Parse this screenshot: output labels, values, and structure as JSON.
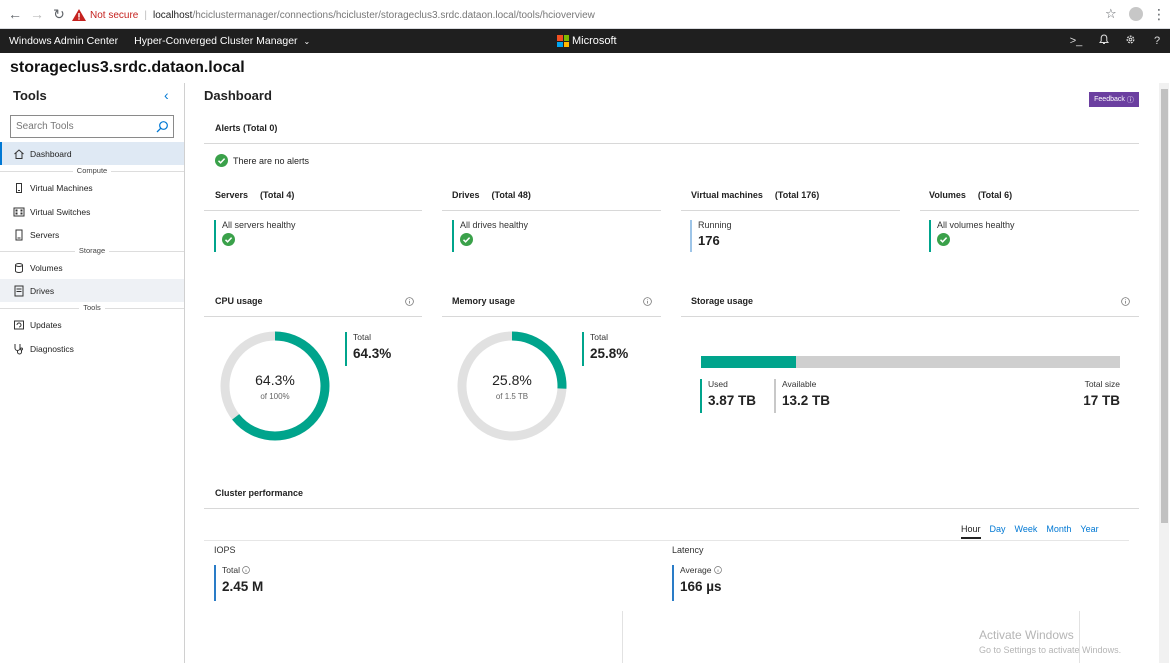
{
  "browser": {
    "not_secure": "Not secure",
    "url_host": "localhost",
    "url_path": "/hciclustermanager/connections/hcicluster/storageclus3.srdc.dataon.local/tools/hcioverview"
  },
  "app": {
    "name": "Windows Admin Center",
    "manager": "Hyper-Converged Cluster Manager",
    "brand": "Microsoft"
  },
  "server_title": "storageclus3.srdc.dataon.local",
  "sidebar": {
    "heading": "Tools",
    "search_placeholder": "Search Tools",
    "items": [
      {
        "label": "Dashboard",
        "icon": "home-icon"
      },
      {
        "group": "Compute"
      },
      {
        "label": "Virtual Machines",
        "icon": "vm-icon"
      },
      {
        "label": "Virtual Switches",
        "icon": "switch-icon"
      },
      {
        "label": "Servers",
        "icon": "server-icon"
      },
      {
        "group": "Storage"
      },
      {
        "label": "Volumes",
        "icon": "cylinder-icon"
      },
      {
        "label": "Drives",
        "icon": "drive-icon"
      },
      {
        "group": "Tools"
      },
      {
        "label": "Updates",
        "icon": "updates-icon"
      },
      {
        "label": "Diagnostics",
        "icon": "stethoscope-icon"
      }
    ]
  },
  "dashboard": {
    "title": "Dashboard",
    "feedback": "Feedback",
    "alerts": {
      "title": "Alerts (Total 0)",
      "message": "There are no alerts"
    },
    "servers": {
      "title": "Servers",
      "total": "(Total 4)",
      "status": "All servers healthy"
    },
    "drives": {
      "title": "Drives",
      "total": "(Total 48)",
      "status": "All drives healthy"
    },
    "vms": {
      "title": "Virtual machines",
      "total": "(Total 176)",
      "status": "Running",
      "count": "176"
    },
    "volumes": {
      "title": "Volumes",
      "total": "(Total 6)",
      "status": "All volumes healthy"
    },
    "cpu": {
      "title": "CPU usage",
      "percent": 64.3,
      "center": "64.3%",
      "of": "of 100%",
      "total_label": "Total",
      "total_value": "64.3%"
    },
    "memory": {
      "title": "Memory usage",
      "percent": 25.8,
      "center": "25.8%",
      "of": "of 1.5 TB",
      "total_label": "Total",
      "total_value": "25.8%"
    },
    "storage": {
      "title": "Storage usage",
      "used_fraction": 0.2277,
      "used_label": "Used",
      "used_value": "3.87 TB",
      "available_label": "Available",
      "available_value": "13.2 TB",
      "total_label": "Total size",
      "total_value": "17 TB"
    },
    "performance": {
      "title": "Cluster performance",
      "ranges": [
        "Hour",
        "Day",
        "Week",
        "Month",
        "Year"
      ],
      "selected_range": "Hour",
      "iops": {
        "title": "IOPS",
        "label": "Total",
        "value": "2.45 M"
      },
      "latency": {
        "title": "Latency",
        "label": "Average",
        "value": "166 µs"
      }
    }
  },
  "watermark": {
    "line1": "Activate Windows",
    "line2": "Go to Settings to activate Windows."
  },
  "colors": {
    "accent": "#00a48c",
    "link": "#0078d4",
    "feedback": "#6b3fa0",
    "header": "#1f1f1f"
  }
}
